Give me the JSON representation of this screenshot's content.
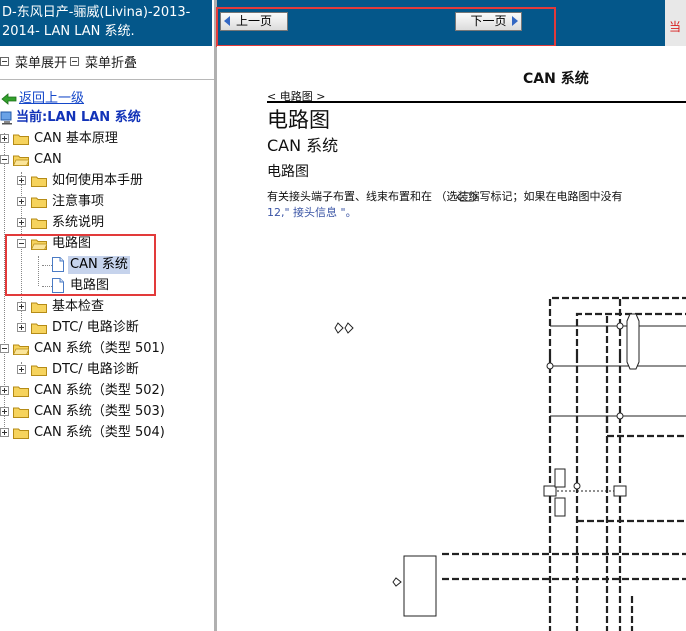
{
  "sidebar": {
    "title_line1": "D-东风日产-骊威(Livina)-2013-",
    "title_line2": "2014- LAN LAN 系统.",
    "menu_expand": "菜单展开",
    "menu_collapse": "菜单折叠",
    "back_link": "返回上一级",
    "current": "当前:LAN LAN 系统",
    "tree": [
      {
        "label": "CAN 基本原理"
      },
      {
        "label": "CAN"
      },
      {
        "label": "如何使用本手册"
      },
      {
        "label": "注意事项"
      },
      {
        "label": "系统说明"
      },
      {
        "label": "电路图"
      },
      {
        "label": "CAN 系统"
      },
      {
        "label": "电路图"
      },
      {
        "label": "基本检查"
      },
      {
        "label": "DTC/ 电路诊断"
      },
      {
        "label": "CAN 系统（类型 501)"
      },
      {
        "label": "DTC/ 电路诊断"
      },
      {
        "label": "CAN 系统（类型 502)"
      },
      {
        "label": "CAN 系统（类型 503)"
      },
      {
        "label": "CAN 系统（类型 504)"
      }
    ]
  },
  "toolbar": {
    "prev_label": "上一页",
    "next_label": "下一页",
    "corner_text": "当"
  },
  "document": {
    "header_title": "CAN 系统",
    "breadcrumb": "< 电路图 >",
    "h1": "电路图",
    "h2": "CAN 系统",
    "h3": "电路图",
    "para_line1": "有关接头端子布置、线束布置和在         （选装缩写标记；如果在电路图中没有",
    "para_line2": "12,\" 接头信息 \"。"
  },
  "colors": {
    "header_bg": "#04578a",
    "highlight_box": "#e23a3a",
    "link": "#1447c9",
    "selected_bg": "#c6d3ec"
  }
}
